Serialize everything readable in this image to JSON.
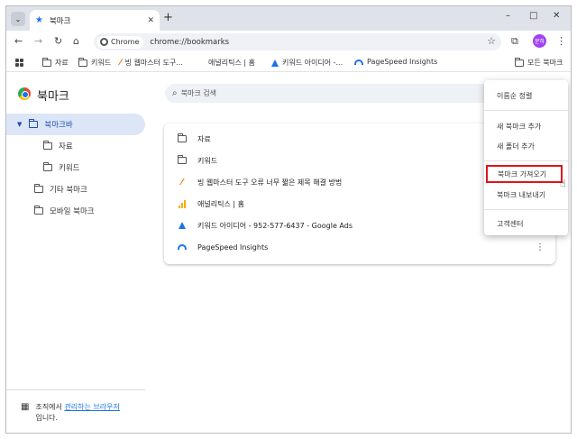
{
  "window": {
    "tab_title": "북마크",
    "minimize": "–",
    "maximize": "□",
    "close": "✕"
  },
  "toolbar": {
    "chip_label": "Chrome",
    "url": "chrome://bookmarks",
    "profile_initials": "분하"
  },
  "bookmarks_bar": {
    "items": [
      {
        "label": "자료",
        "icon": "folder-icon"
      },
      {
        "label": "키워드",
        "icon": "folder-icon"
      },
      {
        "label": "빙 웹마스터 도구...",
        "icon": "bing-icon"
      },
      {
        "label": "애널리틱스 | 홈",
        "icon": "analytics-icon"
      },
      {
        "label": "키워드 아이디어 -...",
        "icon": "google-ads-icon"
      },
      {
        "label": "PageSpeed Insights",
        "icon": "pagespeed-icon"
      }
    ],
    "all_bookmarks": "모든 북마크"
  },
  "page": {
    "title": "북마크",
    "search_placeholder": "북마크 검색"
  },
  "sidebar": {
    "items": [
      {
        "label": "북마크바",
        "selected": true
      },
      {
        "label": "자료"
      },
      {
        "label": "키워드"
      },
      {
        "label": "기타 북마크"
      },
      {
        "label": "모바일 북마크"
      }
    ],
    "managed_prefix": "조직에서 ",
    "managed_link": "관리하는 브라우저",
    "managed_suffix": "입니다."
  },
  "list": {
    "rows": [
      {
        "label": "자료",
        "icon": "folder-icon"
      },
      {
        "label": "키워드",
        "icon": "folder-icon"
      },
      {
        "label": "빙 웹마스터 도구 오류 너무 짧은 제목 해결 방법",
        "icon": "bing-icon"
      },
      {
        "label": "애널리틱스 | 홈",
        "icon": "analytics-icon"
      },
      {
        "label": "키워드 아이디어 - 952-577-6437 - Google Ads",
        "icon": "google-ads-icon"
      },
      {
        "label": "PageSpeed Insights",
        "icon": "pagespeed-icon"
      }
    ]
  },
  "menu": {
    "sort": "이름순 정렬",
    "add_bookmark": "새 북마크 추가",
    "add_folder": "새 폴더 추가",
    "import": "북마크 가져오기",
    "export": "북마크 내보내기",
    "help": "고객센터"
  },
  "colors": {
    "accent": "#1a73e8",
    "selection": "#dde6f7",
    "highlight_border": "#e0141e"
  }
}
